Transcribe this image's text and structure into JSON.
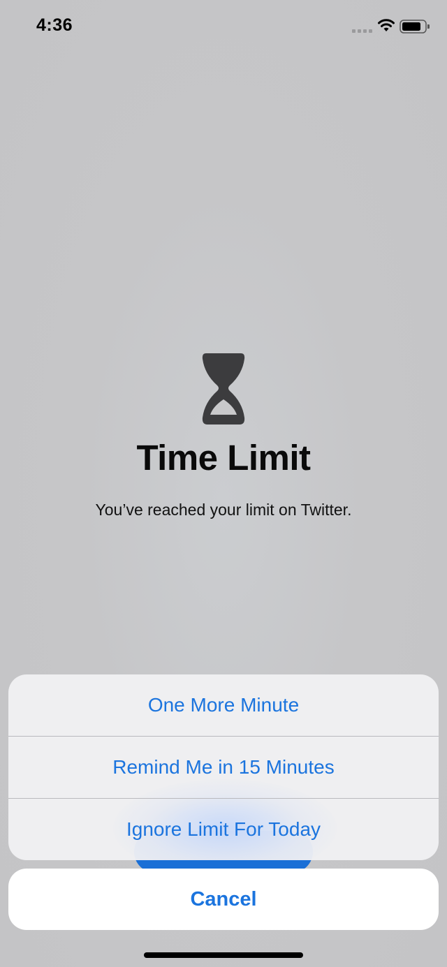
{
  "status_bar": {
    "time": "4:36",
    "icons": [
      "signal-icon",
      "wifi-icon",
      "battery-icon"
    ]
  },
  "screen": {
    "icon": "hourglass-icon",
    "title": "Time Limit",
    "message": "You’ve reached your limit on Twitter."
  },
  "action_sheet": {
    "items": [
      {
        "label": "One More Minute"
      },
      {
        "label": "Remind Me in 15 Minutes"
      },
      {
        "label": "Ignore Limit For Today"
      }
    ],
    "cancel_label": "Cancel"
  },
  "colors": {
    "accent": "#1b74de",
    "background": "#c6c6c8",
    "sheet": "#f0f0f2"
  }
}
